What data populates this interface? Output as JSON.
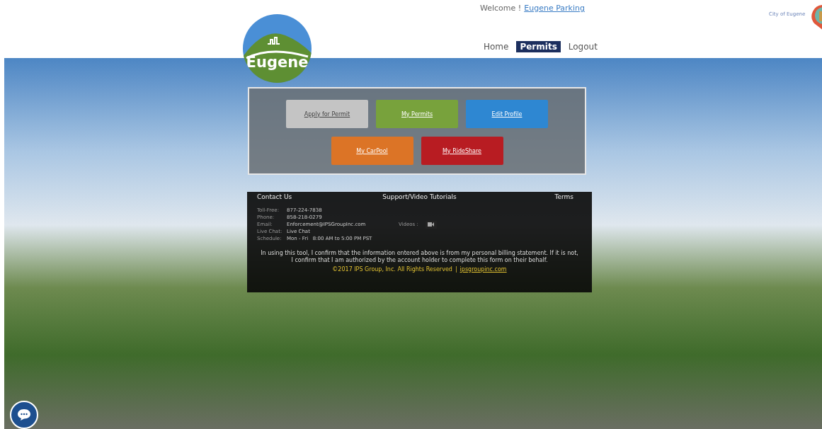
{
  "header": {
    "welcome_label": "Welcome !",
    "user_link": "Eugene Parking",
    "logo_text": "Eugene",
    "city_link": "City of Eugene"
  },
  "nav": [
    {
      "label": "Home",
      "selected": false
    },
    {
      "label": "Permits",
      "selected": true
    },
    {
      "label": "Logout",
      "selected": false
    }
  ],
  "actions": [
    {
      "label": "Apply for Permit",
      "color": "#c4c4c4"
    },
    {
      "label": "My Permits",
      "color": "#78a23c"
    },
    {
      "label": "Edit Profile",
      "color": "#2e87d2"
    },
    {
      "label": "My CarPool",
      "color": "#dc7426"
    },
    {
      "label": "My RideShare",
      "color": "#b81c22"
    }
  ],
  "footer": {
    "contact_heading": "Contact Us",
    "support_heading": "Support/Video Tutorials",
    "terms_heading": "Terms",
    "contacts": [
      {
        "label": "Toll-Free:",
        "value": "877-224-7838"
      },
      {
        "label": "Phone:",
        "value": "858-218-0279"
      },
      {
        "label": "Email:",
        "value": "Enforcement@IPSGroupInc.com"
      },
      {
        "label": "Live Chat:",
        "value": "Live Chat"
      },
      {
        "label": "Schedule:",
        "value": "Mon - Fri   8:00 AM to 5:00 PM PST"
      }
    ],
    "videos_label": "Videos :",
    "disclaimer": "In using this tool, I confirm that the information entered above is from my personal billing statement. If it is not, I confirm that I am authorized by the account holder to complete this form on their behalf.",
    "copyright": "©2017 IPS Group, Inc. All Rights Reserved",
    "separator": "|",
    "site_link": "ipsgroupinc.com"
  }
}
